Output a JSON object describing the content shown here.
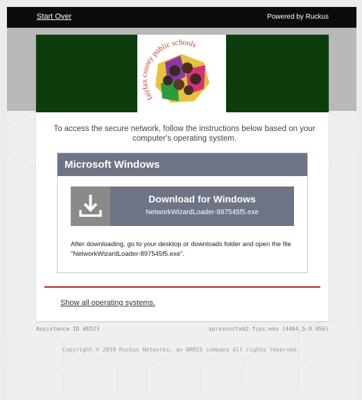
{
  "topbar": {
    "start_over": "Start Over",
    "powered_by": "Powered by Ruckus"
  },
  "banner": {
    "logo_text": "fairfax county public schools",
    "bg_color": "#0d3d0c"
  },
  "intro": {
    "text": "To access the secure network, follow the instructions below based on your computer's operating system."
  },
  "os_panel": {
    "title": "Microsoft Windows",
    "download_title": "Download for Windows",
    "download_file": "NetworkWizardLoader-897545f5.exe",
    "instructions": "After downloading, go to your desktop or downloads folder and open the file \"NetworkWizardLoader-897545f5.exe\".",
    "accent": "#6e7485",
    "icon": "download-icon"
  },
  "show_all": "Show all operating systems.",
  "footer": {
    "assistance_id": "Assistance ID #ED23",
    "server": "xprsscnctvm2.fcps.edu (4464.5.0.956)",
    "copyright": "Copyright © 2019 Ruckus Networks, an ARRIS company All rights reserved."
  }
}
